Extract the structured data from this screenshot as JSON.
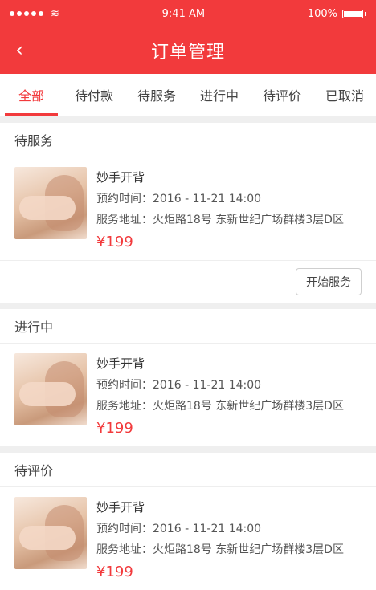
{
  "status": {
    "time": "9:41 AM",
    "battery": "100%"
  },
  "navbar": {
    "title": "订单管理"
  },
  "tabs": [
    "全部",
    "待付款",
    "待服务",
    "进行中",
    "待评价",
    "已取消"
  ],
  "sections": [
    {
      "header": "待服务",
      "order": {
        "name": "妙手开背",
        "time": "预约时间：2016 - 11-21 14:00",
        "address": "服务地址：火炬路18号 东新世纪广场群楼3层D区",
        "price": "¥199",
        "action": "开始服务"
      }
    },
    {
      "header": "进行中",
      "order": {
        "name": "妙手开背",
        "time": "预约时间：2016 - 11-21 14:00",
        "address": "服务地址：火炬路18号 东新世纪广场群楼3层D区",
        "price": "¥199"
      }
    },
    {
      "header": "待评价",
      "order": {
        "name": "妙手开背",
        "time": "预约时间：2016 - 11-21 14:00",
        "address": "服务地址：火炬路18号 东新世纪广场群楼3层D区",
        "price": "¥199"
      }
    }
  ]
}
